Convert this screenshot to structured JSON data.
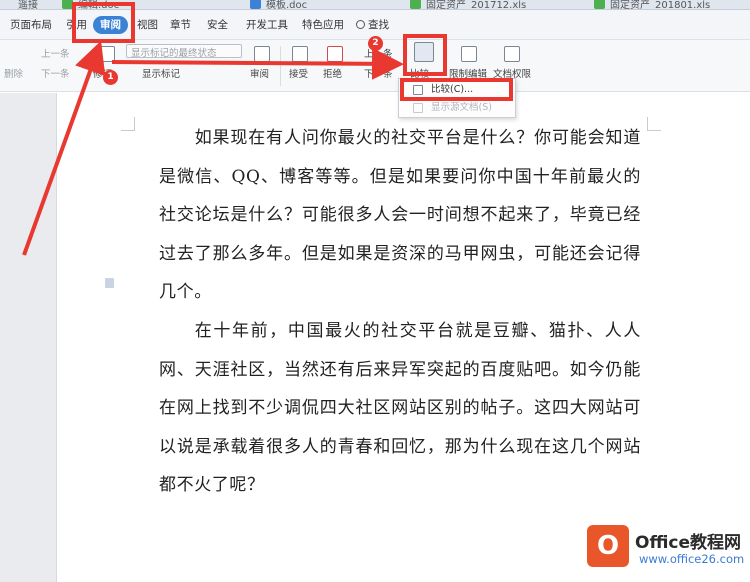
{
  "tabs": [
    {
      "label": "遥接",
      "color": "#6b8fb5"
    },
    {
      "label": "编辑.doc",
      "color": "#4caf50"
    },
    {
      "label": "模板.doc",
      "color": "#3b82d6"
    },
    {
      "label": "固定资产_201712.xls",
      "color": "#4caf50"
    },
    {
      "label": "固定资产_201801.xls",
      "color": "#4caf50"
    }
  ],
  "menu": {
    "items": [
      "页面布局",
      "引用",
      "审阅",
      "视图",
      "章节",
      "安全",
      "开发工具",
      "特色应用"
    ],
    "active": "审阅",
    "search_label": "查找"
  },
  "toolbar": {
    "prev_label": "上一条",
    "next_label": "下一条",
    "delete_label": "删除",
    "track_label": "修订",
    "markup_select": "显示标记的最终状态",
    "show_markup_label": "显示标记",
    "review_label": "审阅",
    "accept_label": "接受",
    "reject_label": "拒绝",
    "prev2_label": "上一条",
    "next2_label": "下一条",
    "compare_label": "比较",
    "restrict_label": "限制编辑",
    "permission_label": "文档权限"
  },
  "dropdown": {
    "compare_item": "比较(C)...",
    "show_source_item": "显示源文档(S)"
  },
  "document": {
    "paragraph1": "如果现在有人问你最火的社交平台是什么？你可能会知道是微信、QQ、博客等等。但是如果要问你中国十年前最火的社交论坛是什么？可能很多人会一时间想不起来了，毕竟已经过去了那么多年。但是如果是资深的马甲网虫，可能还会记得几个。",
    "paragraph2": "在十年前，中国最火的社交平台就是豆瓣、猫扑、人人网、天涯社区，当然还有后来异军突起的百度贴吧。如今仍能在网上找到不少调侃四大社区网站区别的帖子。这四大网站可以说是承载着很多人的青春和回忆，那为什么现在这几个网站都不火了呢？"
  },
  "annotations": {
    "step1": "1",
    "step2": "2",
    "color": "#e8382f"
  },
  "watermark": {
    "logo_letter": "O",
    "name": "Office教程网",
    "url": "www.office26.com"
  }
}
